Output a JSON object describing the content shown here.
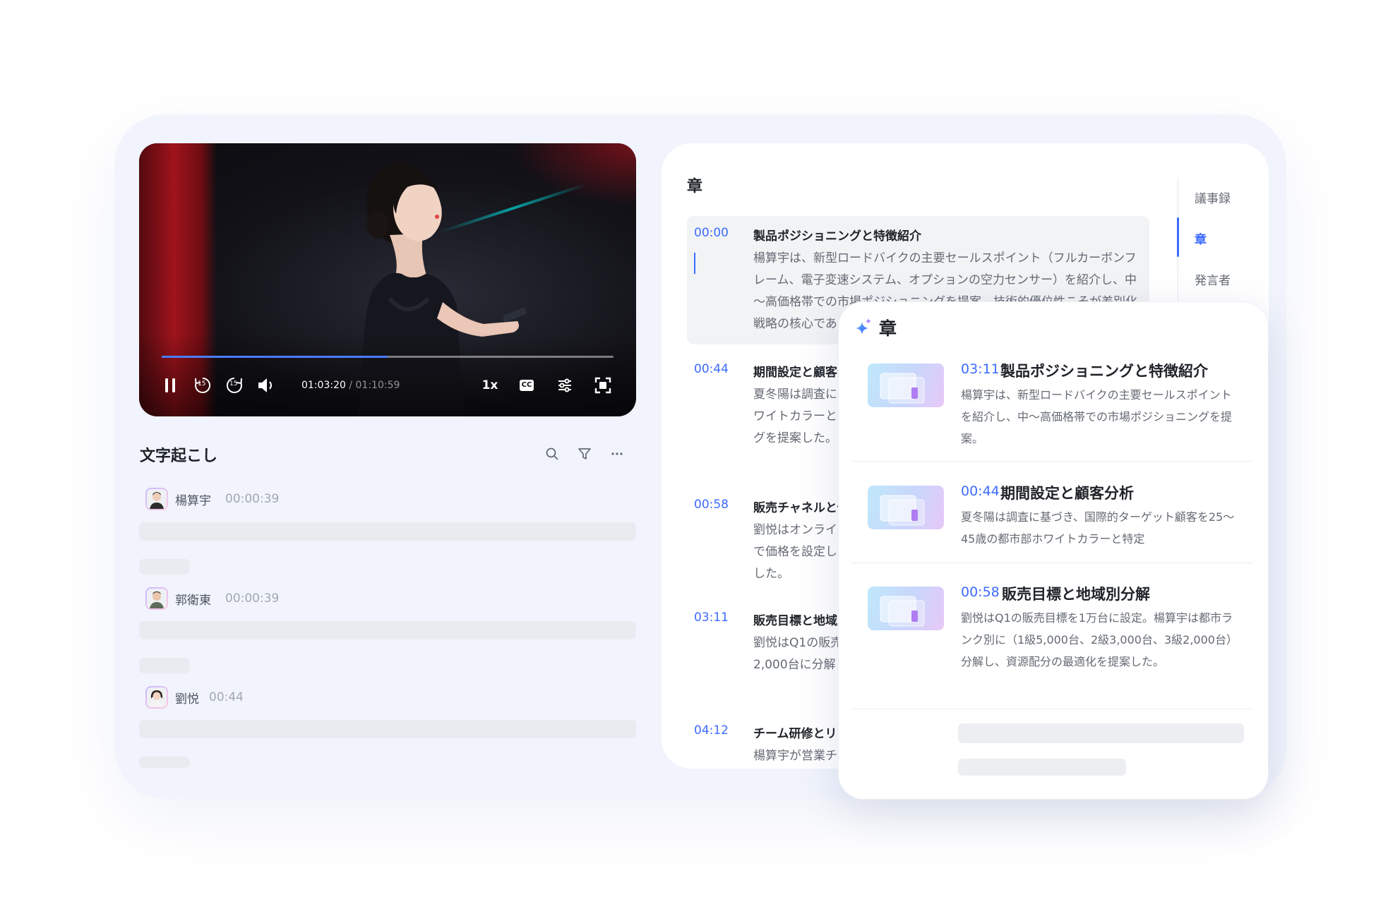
{
  "player": {
    "current_time": "01:03:20",
    "separator": " / ",
    "total_time": "01:10:59",
    "progress": 0.5,
    "speed": "1x",
    "cc_label": "CC",
    "rewind_seconds": "15",
    "forward_seconds": "15",
    "accent": "#4a7dff"
  },
  "transcript": {
    "title": "文字起こし",
    "entries": [
      {
        "name": "楊算宇",
        "time": "00:00:39"
      },
      {
        "name": "郭衛東",
        "time": "00:00:39"
      },
      {
        "name": "劉悦",
        "time": "00:44"
      }
    ]
  },
  "chapters": {
    "title": "章",
    "items": [
      {
        "time": "00:00",
        "heading": "製品ポジショニングと特徴紹介",
        "desc": "楊算宇は、新型ロードバイクの主要セールスポイント（フルカーボンフレーム、電子変速システム、オプションの空力センサー）を紹介し、中～高価格帯での市場ポジショニングを提案。技術的優位性こそが差別化戦略の核心であると強調した。"
      },
      {
        "time": "00:44",
        "heading": "期間設定と顧客分析",
        "desc": "夏冬陽は調査に基づき、国際的ターゲット顧客を25～45歳の都市部ホワイトカラーと特定し、健康志向を軸に、SNSを活用したマーケティングを提案した。"
      },
      {
        "time": "00:58",
        "heading": "販売チャネルと価格戦略",
        "desc": "劉悦はオンライン直販とオフライン代理店を組み合わせ、コストベースで価格を設定し、代理店のマージンを補足し、付加価値サービスを提案した。"
      },
      {
        "time": "03:11",
        "heading": "販売目標と地域別分解",
        "desc": "劉悦はQ1の販売目標を1万台に設定。1級5,000台、2級3,000台、3級2,000台に分解し、資源配分の最適化を提案した。"
      },
      {
        "time": "04:12",
        "heading": "チーム研修とリソース",
        "desc": "楊算宇が営業チームの研修計画を説明した。"
      }
    ]
  },
  "side_tabs": [
    "議事録",
    "章",
    "発言者"
  ],
  "popup": {
    "title": "章",
    "items": [
      {
        "time": "03:11",
        "heading": "製品ポジショニングと特徴紹介",
        "desc": "楊算宇は、新型ロードバイクの主要セールスポイントを紹介し、中～高価格帯での市場ポジショニングを提案。"
      },
      {
        "time": "00:44",
        "heading": "期間設定と顧客分析",
        "desc": "夏冬陽は調査に基づき、国際的ターゲット顧客を25～45歳の都市部ホワイトカラーと特定"
      },
      {
        "time": "00:58",
        "heading": "販売目標と地域別分解",
        "desc": "劉悦はQ1の販売目標を1万台に設定。楊算宇は都市ランク別に（1級5,000台、2級3,000台、3級2,000台）分解し、資源配分の最適化を提案した。"
      }
    ]
  }
}
